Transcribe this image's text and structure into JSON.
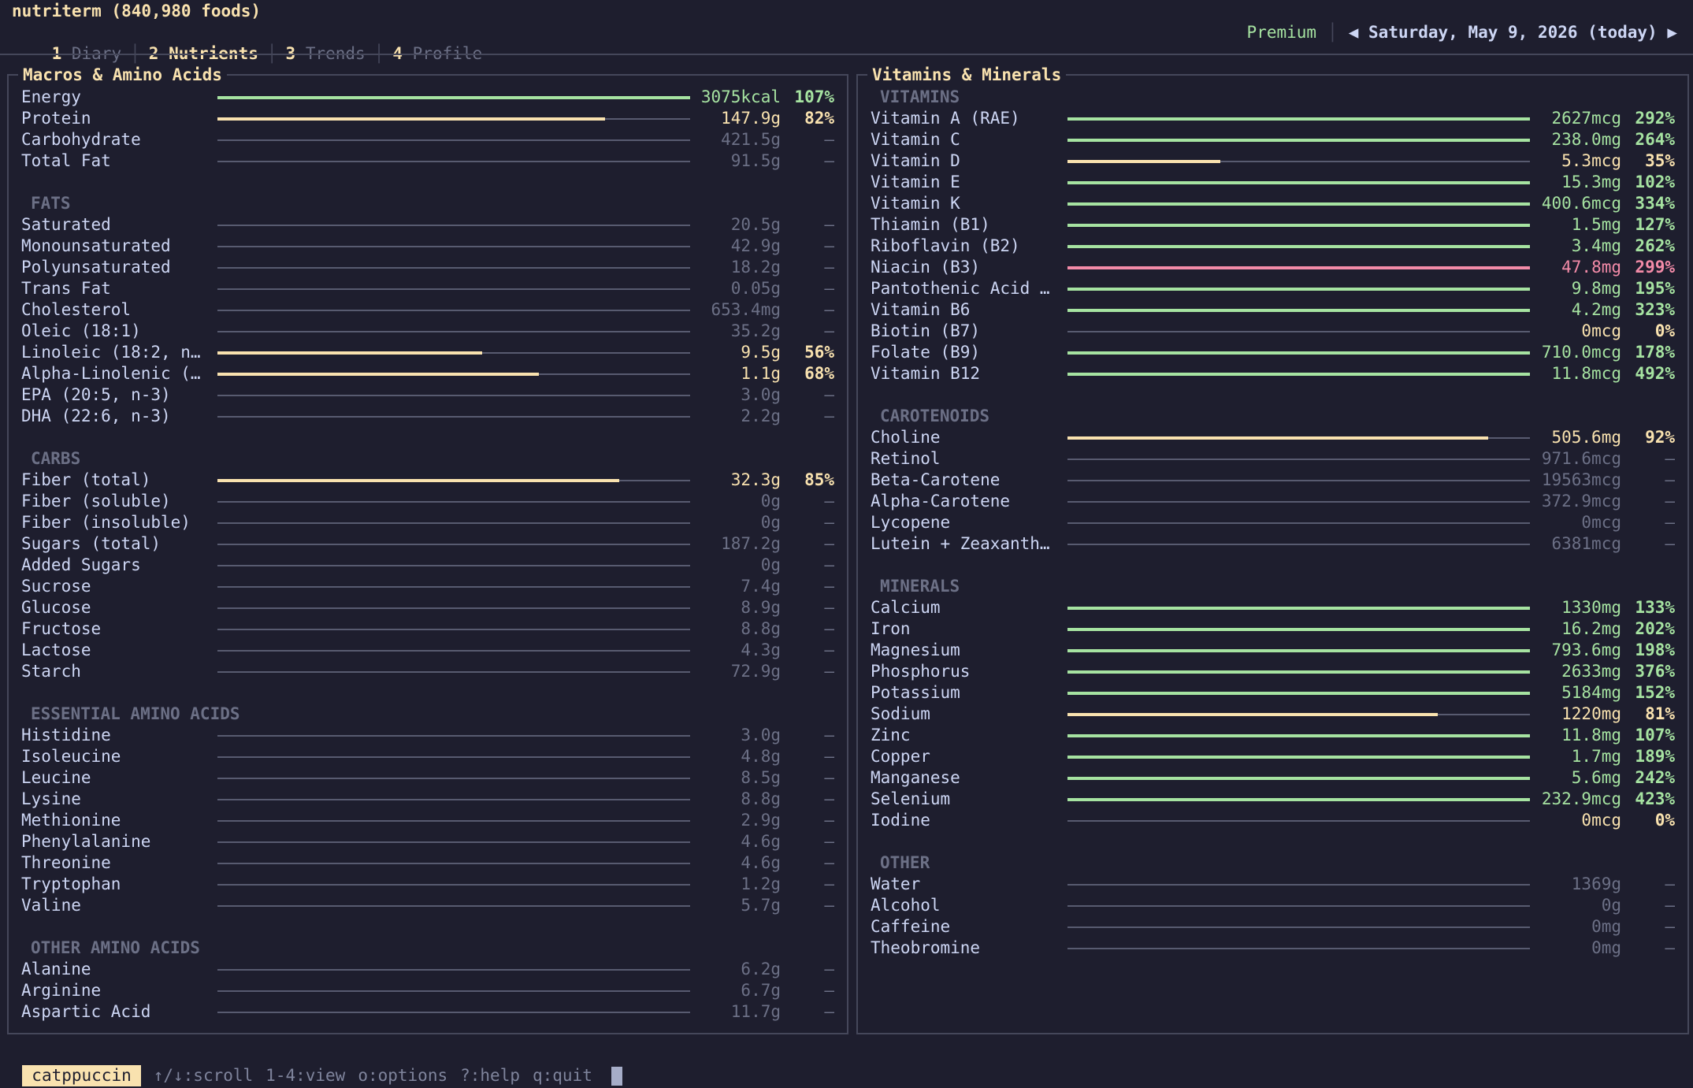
{
  "header": {
    "title": "nutriterm (840,980 foods)",
    "tabs": [
      {
        "num": "1",
        "label": "Diary"
      },
      {
        "num": "2",
        "label": "Nutrients"
      },
      {
        "num": "3",
        "label": "Trends"
      },
      {
        "num": "4",
        "label": "Profile"
      }
    ],
    "active_tab": "Nutrients",
    "premium": "Premium",
    "prev_arrow": "◀",
    "date": "Saturday, May 9, 2026 (today)",
    "next_arrow": "▶"
  },
  "colors": {
    "background": "#1e1e2e",
    "green": "#a6e3a1",
    "yellow": "#f9e2af",
    "red": "#f38ba8",
    "dim": "#6c7086",
    "text": "#cdd6f4"
  },
  "left_panel": {
    "title": "Macros & Amino Acids",
    "rows": [
      {
        "label": "Energy",
        "value": "3075kcal",
        "pct": "107%",
        "fill": 1.0,
        "status": "green"
      },
      {
        "label": "Protein",
        "value": "147.9g",
        "pct": "82%",
        "fill": 0.82,
        "status": "yellow"
      },
      {
        "label": "Carbohydrate",
        "value": "421.5g",
        "pct": "–"
      },
      {
        "label": "Total Fat",
        "value": "91.5g",
        "pct": "–"
      },
      {
        "blank": true
      },
      {
        "section": "FATS"
      },
      {
        "label": "Saturated",
        "value": "20.5g",
        "pct": "–"
      },
      {
        "label": "Monounsaturated",
        "value": "42.9g",
        "pct": "–"
      },
      {
        "label": "Polyunsaturated",
        "value": "18.2g",
        "pct": "–"
      },
      {
        "label": "Trans Fat",
        "value": "0.05g",
        "pct": "–"
      },
      {
        "label": "Cholesterol",
        "value": "653.4mg",
        "pct": "–"
      },
      {
        "label": "Oleic (18:1)",
        "value": "35.2g",
        "pct": "–"
      },
      {
        "label": "Linoleic (18:2, n…",
        "value": "9.5g",
        "pct": "56%",
        "fill": 0.56,
        "status": "yellow"
      },
      {
        "label": "Alpha-Linolenic (…",
        "value": "1.1g",
        "pct": "68%",
        "fill": 0.68,
        "status": "yellow"
      },
      {
        "label": "EPA (20:5, n-3)",
        "value": "3.0g",
        "pct": "–"
      },
      {
        "label": "DHA (22:6, n-3)",
        "value": "2.2g",
        "pct": "–"
      },
      {
        "blank": true
      },
      {
        "section": "CARBS"
      },
      {
        "label": "Fiber (total)",
        "value": "32.3g",
        "pct": "85%",
        "fill": 0.85,
        "status": "yellow"
      },
      {
        "label": "Fiber (soluble)",
        "value": "0g",
        "pct": "–"
      },
      {
        "label": "Fiber (insoluble)",
        "value": "0g",
        "pct": "–"
      },
      {
        "label": "Sugars (total)",
        "value": "187.2g",
        "pct": "–"
      },
      {
        "label": "Added Sugars",
        "value": "0g",
        "pct": "–"
      },
      {
        "label": "Sucrose",
        "value": "7.4g",
        "pct": "–"
      },
      {
        "label": "Glucose",
        "value": "8.9g",
        "pct": "–"
      },
      {
        "label": "Fructose",
        "value": "8.8g",
        "pct": "–"
      },
      {
        "label": "Lactose",
        "value": "4.3g",
        "pct": "–"
      },
      {
        "label": "Starch",
        "value": "72.9g",
        "pct": "–"
      },
      {
        "blank": true
      },
      {
        "section": "ESSENTIAL AMINO ACIDS"
      },
      {
        "label": "Histidine",
        "value": "3.0g",
        "pct": "–"
      },
      {
        "label": "Isoleucine",
        "value": "4.8g",
        "pct": "–"
      },
      {
        "label": "Leucine",
        "value": "8.5g",
        "pct": "–"
      },
      {
        "label": "Lysine",
        "value": "8.8g",
        "pct": "–"
      },
      {
        "label": "Methionine",
        "value": "2.9g",
        "pct": "–"
      },
      {
        "label": "Phenylalanine",
        "value": "4.6g",
        "pct": "–"
      },
      {
        "label": "Threonine",
        "value": "4.6g",
        "pct": "–"
      },
      {
        "label": "Tryptophan",
        "value": "1.2g",
        "pct": "–"
      },
      {
        "label": "Valine",
        "value": "5.7g",
        "pct": "–"
      },
      {
        "blank": true
      },
      {
        "section": "OTHER AMINO ACIDS"
      },
      {
        "label": "Alanine",
        "value": "6.2g",
        "pct": "–"
      },
      {
        "label": "Arginine",
        "value": "6.7g",
        "pct": "–"
      },
      {
        "label": "Aspartic Acid",
        "value": "11.7g",
        "pct": "–"
      }
    ]
  },
  "right_panel": {
    "title": "Vitamins & Minerals",
    "rows": [
      {
        "section": "VITAMINS"
      },
      {
        "label": "Vitamin A (RAE)",
        "value": "2627mcg",
        "pct": "292%",
        "fill": 1.0,
        "status": "green"
      },
      {
        "label": "Vitamin C",
        "value": "238.0mg",
        "pct": "264%",
        "fill": 1.0,
        "status": "green"
      },
      {
        "label": "Vitamin D",
        "value": "5.3mcg",
        "pct": "35%",
        "fill": 0.33,
        "status": "yellow"
      },
      {
        "label": "Vitamin E",
        "value": "15.3mg",
        "pct": "102%",
        "fill": 1.0,
        "status": "green"
      },
      {
        "label": "Vitamin K",
        "value": "400.6mcg",
        "pct": "334%",
        "fill": 1.0,
        "status": "green"
      },
      {
        "label": "Thiamin (B1)",
        "value": "1.5mg",
        "pct": "127%",
        "fill": 1.0,
        "status": "green"
      },
      {
        "label": "Riboflavin (B2)",
        "value": "3.4mg",
        "pct": "262%",
        "fill": 1.0,
        "status": "green"
      },
      {
        "label": "Niacin (B3)",
        "value": "47.8mg",
        "pct": "299%",
        "fill": 1.0,
        "status": "red"
      },
      {
        "label": "Pantothenic Acid …",
        "value": "9.8mg",
        "pct": "195%",
        "fill": 1.0,
        "status": "green"
      },
      {
        "label": "Vitamin B6",
        "value": "4.2mg",
        "pct": "323%",
        "fill": 1.0,
        "status": "green"
      },
      {
        "label": "Biotin (B7)",
        "value": "0mcg",
        "pct": "0%",
        "fill": 0,
        "status": "yellow"
      },
      {
        "label": "Folate (B9)",
        "value": "710.0mcg",
        "pct": "178%",
        "fill": 1.0,
        "status": "green"
      },
      {
        "label": "Vitamin B12",
        "value": "11.8mcg",
        "pct": "492%",
        "fill": 1.0,
        "status": "green"
      },
      {
        "blank": true
      },
      {
        "section": "CAROTENOIDS"
      },
      {
        "label": "Choline",
        "value": "505.6mg",
        "pct": "92%",
        "fill": 0.91,
        "status": "yellow"
      },
      {
        "label": "Retinol",
        "value": "971.6mcg",
        "pct": "–"
      },
      {
        "label": "Beta-Carotene",
        "value": "19563mcg",
        "pct": "–"
      },
      {
        "label": "Alpha-Carotene",
        "value": "372.9mcg",
        "pct": "–"
      },
      {
        "label": "Lycopene",
        "value": "0mcg",
        "pct": "–"
      },
      {
        "label": "Lutein + Zeaxanth…",
        "value": "6381mcg",
        "pct": "–"
      },
      {
        "blank": true
      },
      {
        "section": "MINERALS"
      },
      {
        "label": "Calcium",
        "value": "1330mg",
        "pct": "133%",
        "fill": 1.0,
        "status": "green"
      },
      {
        "label": "Iron",
        "value": "16.2mg",
        "pct": "202%",
        "fill": 1.0,
        "status": "green"
      },
      {
        "label": "Magnesium",
        "value": "793.6mg",
        "pct": "198%",
        "fill": 1.0,
        "status": "green"
      },
      {
        "label": "Phosphorus",
        "value": "2633mg",
        "pct": "376%",
        "fill": 1.0,
        "status": "green"
      },
      {
        "label": "Potassium",
        "value": "5184mg",
        "pct": "152%",
        "fill": 1.0,
        "status": "green"
      },
      {
        "label": "Sodium",
        "value": "1220mg",
        "pct": "81%",
        "fill": 0.8,
        "status": "yellow"
      },
      {
        "label": "Zinc",
        "value": "11.8mg",
        "pct": "107%",
        "fill": 1.0,
        "status": "green"
      },
      {
        "label": "Copper",
        "value": "1.7mg",
        "pct": "189%",
        "fill": 1.0,
        "status": "green"
      },
      {
        "label": "Manganese",
        "value": "5.6mg",
        "pct": "242%",
        "fill": 1.0,
        "status": "green"
      },
      {
        "label": "Selenium",
        "value": "232.9mcg",
        "pct": "423%",
        "fill": 1.0,
        "status": "green"
      },
      {
        "label": "Iodine",
        "value": "0mcg",
        "pct": "0%",
        "fill": 0,
        "status": "yellow"
      },
      {
        "blank": true
      },
      {
        "section": "OTHER"
      },
      {
        "label": "Water",
        "value": "1369g",
        "pct": "–"
      },
      {
        "label": "Alcohol",
        "value": "0g",
        "pct": "–"
      },
      {
        "label": "Caffeine",
        "value": "0mg",
        "pct": "–"
      },
      {
        "label": "Theobromine",
        "value": "0mg",
        "pct": "–"
      }
    ]
  },
  "status_bar": {
    "theme": "catppuccin",
    "hints": [
      "↑/↓:scroll",
      "1-4:view",
      "o:options",
      "?:help",
      "q:quit"
    ]
  }
}
